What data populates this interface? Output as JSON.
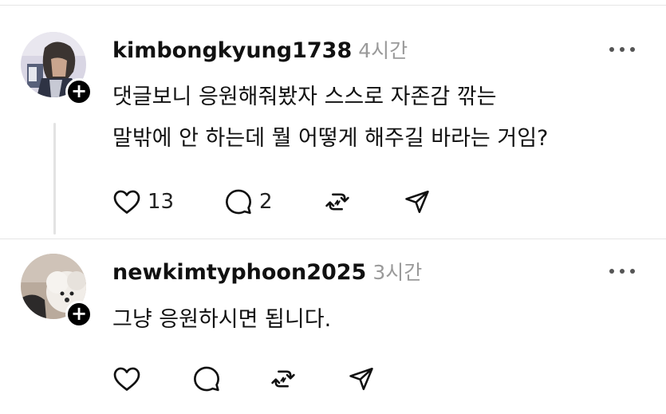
{
  "comments": [
    {
      "username": "kimbongkyung1738",
      "time": "4시간",
      "lines": [
        "댓글보니 응원해줘봤자 스스로 자존감 깎는",
        "말밖에 안 하는데 뭘 어떻게 해주길 바라는 거임?"
      ],
      "likes": "13",
      "replies": "2",
      "follow_icon": "+"
    },
    {
      "username": "newkimtyphoon2025",
      "time": "3시간",
      "lines": [
        "그냥 응원하시면 됩니다."
      ],
      "likes": "",
      "replies": "",
      "follow_icon": "+"
    }
  ],
  "icons": {
    "like": "heart-icon",
    "reply": "speech-bubble-icon",
    "repost": "repost-icon",
    "share": "send-icon",
    "more": "more-horizontal-icon"
  },
  "colors": {
    "text": "#111111",
    "muted": "#9a9a9a",
    "divider": "#e6e6e6"
  }
}
